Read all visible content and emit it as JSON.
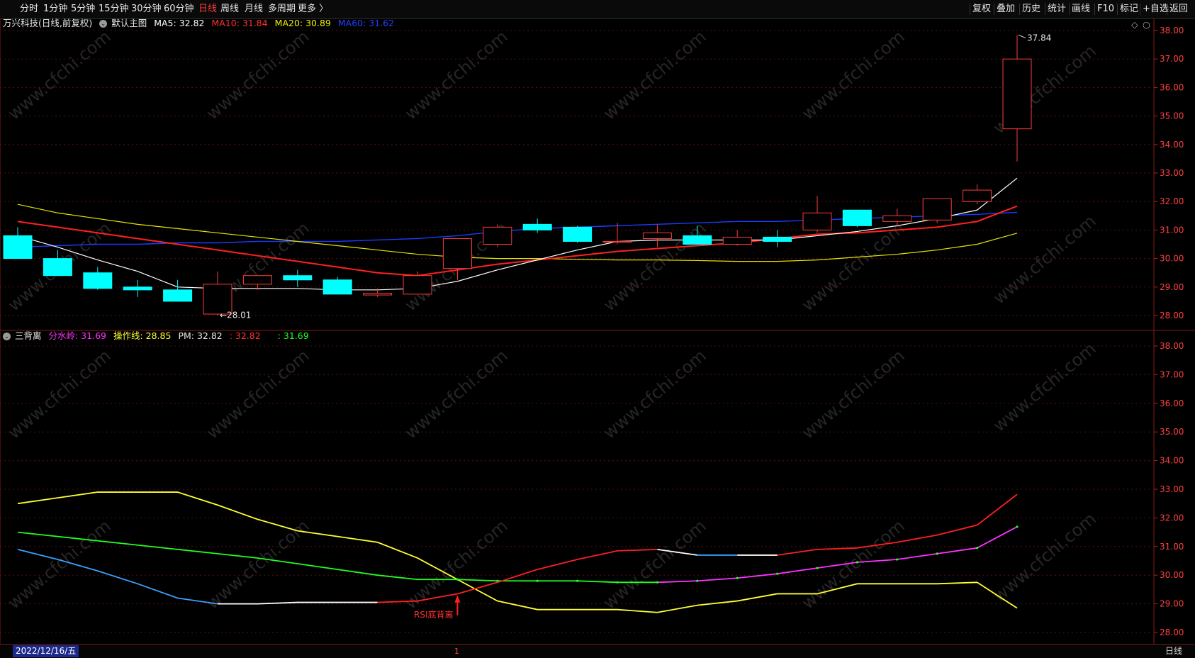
{
  "toolbar": {
    "periods": [
      "分时",
      "1分钟",
      "5分钟",
      "15分钟",
      "30分钟",
      "60分钟",
      "日线",
      "周线",
      "月线",
      "多周期",
      "更多 〉"
    ],
    "active_period": "日线",
    "right_items": [
      "复权",
      "叠加",
      "历史",
      "统计",
      "画线",
      "F10",
      "标记",
      "+自选",
      "返回"
    ]
  },
  "main_panel": {
    "stock_title": "万兴科技(日线,前复权)",
    "template_label": "默认主图",
    "ma5": "MA5: 32.82",
    "ma10": "MA10: 31.84",
    "ma20": "MA20: 30.89",
    "ma60": "MA60: 31.62",
    "high_marker": "37.84",
    "low_marker": "28.01",
    "axis_ticks": [
      "38.00",
      "37.00",
      "36.00",
      "35.00",
      "34.00",
      "33.00",
      "32.00",
      "31.00",
      "30.00",
      "29.00",
      "28.00"
    ]
  },
  "sub_panel": {
    "indicator_name": "三背离",
    "fenshuiling": "分水岭: 31.69",
    "caozuoxian": "操作线: 28.85",
    "pm": "PM: 32.82",
    "red_value": ": 32.82",
    "green_value": ": 31.69",
    "signal_label": "RSI底背离",
    "axis_ticks": [
      "38.00",
      "37.00",
      "36.00",
      "35.00",
      "34.00",
      "33.00",
      "32.00",
      "31.00",
      "30.00",
      "29.00",
      "28.00"
    ]
  },
  "status_bar": {
    "date": "2022/12/16/五",
    "cursor_marker": "1",
    "period": "日线"
  },
  "watermark": "www.cfchi.com",
  "colors": {
    "up": "#ff3c3c",
    "down": "#00ffff",
    "ma5": "#ffffff",
    "ma10": "#ff2020",
    "ma20": "#e6e600",
    "ma60": "#1a3cff",
    "fenshuiling": "#ff33ff",
    "caozuoxian": "#ffff33",
    "green_line": "#22ff22",
    "blue_line": "#3aa0ff"
  },
  "chart_data": {
    "type": "candlestick",
    "ylim": [
      27.6,
      38.3
    ],
    "candles": [
      {
        "o": 30.8,
        "h": 31.1,
        "l": 30.0,
        "c": 30.0
      },
      {
        "o": 30.0,
        "h": 30.3,
        "l": 29.4,
        "c": 29.4
      },
      {
        "o": 29.5,
        "h": 29.7,
        "l": 28.9,
        "c": 28.95
      },
      {
        "o": 29.0,
        "h": 29.25,
        "l": 28.65,
        "c": 28.9
      },
      {
        "o": 28.9,
        "h": 29.25,
        "l": 28.5,
        "c": 28.5
      },
      {
        "o": 28.05,
        "h": 29.55,
        "l": 28.01,
        "c": 29.1
      },
      {
        "o": 29.1,
        "h": 29.4,
        "l": 28.9,
        "c": 29.4
      },
      {
        "o": 29.4,
        "h": 29.6,
        "l": 29.0,
        "c": 29.25
      },
      {
        "o": 29.25,
        "h": 29.35,
        "l": 28.75,
        "c": 28.75
      },
      {
        "o": 28.72,
        "h": 28.95,
        "l": 28.65,
        "c": 28.78
      },
      {
        "o": 28.75,
        "h": 29.55,
        "l": 28.75,
        "c": 29.4
      },
      {
        "o": 29.65,
        "h": 30.7,
        "l": 29.25,
        "c": 30.7
      },
      {
        "o": 30.5,
        "h": 31.2,
        "l": 30.4,
        "c": 31.1
      },
      {
        "o": 31.2,
        "h": 31.4,
        "l": 30.9,
        "c": 31.0
      },
      {
        "o": 31.1,
        "h": 31.15,
        "l": 30.55,
        "c": 30.6
      },
      {
        "o": 30.6,
        "h": 31.25,
        "l": 30.5,
        "c": 30.6
      },
      {
        "o": 30.7,
        "h": 31.2,
        "l": 30.4,
        "c": 30.9
      },
      {
        "o": 30.8,
        "h": 31.15,
        "l": 30.5,
        "c": 30.5
      },
      {
        "o": 30.5,
        "h": 31.0,
        "l": 30.45,
        "c": 30.75
      },
      {
        "o": 30.75,
        "h": 31.0,
        "l": 30.4,
        "c": 30.6
      },
      {
        "o": 31.0,
        "h": 32.2,
        "l": 30.9,
        "c": 31.6
      },
      {
        "o": 31.7,
        "h": 31.7,
        "l": 31.1,
        "c": 31.15
      },
      {
        "o": 31.3,
        "h": 31.75,
        "l": 31.15,
        "c": 31.5
      },
      {
        "o": 31.35,
        "h": 32.1,
        "l": 31.25,
        "c": 32.1
      },
      {
        "o": 32.0,
        "h": 32.6,
        "l": 31.9,
        "c": 32.4
      },
      {
        "o": 34.55,
        "h": 37.84,
        "l": 33.4,
        "c": 37.0
      }
    ],
    "ma5": [
      30.8,
      30.4,
      29.95,
      29.55,
      29.0,
      28.95,
      28.95,
      28.95,
      28.9,
      28.9,
      28.95,
      29.2,
      29.6,
      29.95,
      30.3,
      30.6,
      30.65,
      30.65,
      30.65,
      30.65,
      30.8,
      30.95,
      31.15,
      31.4,
      31.7,
      32.82
    ],
    "ma10": [
      31.3,
      31.1,
      30.9,
      30.7,
      30.5,
      30.3,
      30.1,
      29.9,
      29.7,
      29.5,
      29.4,
      29.6,
      29.8,
      29.95,
      30.1,
      30.25,
      30.35,
      30.45,
      30.55,
      30.7,
      30.85,
      30.9,
      31.0,
      31.1,
      31.3,
      31.84
    ],
    "ma20": [
      31.9,
      31.6,
      31.4,
      31.2,
      31.05,
      30.9,
      30.75,
      30.6,
      30.45,
      30.3,
      30.15,
      30.05,
      30.0,
      30.0,
      29.97,
      29.95,
      29.95,
      29.93,
      29.9,
      29.9,
      29.95,
      30.05,
      30.15,
      30.3,
      30.5,
      30.89
    ],
    "ma60": [
      30.4,
      30.45,
      30.5,
      30.5,
      30.55,
      30.55,
      30.6,
      30.6,
      30.6,
      30.65,
      30.7,
      30.8,
      30.95,
      31.05,
      31.1,
      31.15,
      31.2,
      31.25,
      31.3,
      31.3,
      31.35,
      31.4,
      31.45,
      31.5,
      31.55,
      31.62
    ],
    "sub_ylim": [
      27.6,
      38.3
    ],
    "caozuoxian": [
      32.5,
      32.7,
      32.9,
      32.9,
      32.9,
      32.45,
      31.95,
      31.55,
      31.35,
      31.15,
      30.6,
      29.85,
      29.1,
      28.8,
      28.8,
      28.8,
      28.7,
      28.95,
      29.1,
      29.35,
      29.35,
      29.7,
      29.7,
      29.7,
      29.75,
      28.85
    ],
    "fenshuiling": [
      31.5,
      31.35,
      31.2,
      31.05,
      30.9,
      30.75,
      30.6,
      30.4,
      30.2,
      30.0,
      29.85,
      29.85,
      29.8,
      29.8,
      29.8,
      29.75,
      29.75,
      29.8,
      29.9,
      30.05,
      30.25,
      30.45,
      30.55,
      30.75,
      30.95,
      31.69
    ],
    "pm": [
      30.9,
      30.55,
      30.15,
      29.7,
      29.2,
      29.0,
      29.0,
      29.05,
      29.05,
      29.05,
      29.1,
      29.35,
      29.75,
      30.2,
      30.55,
      30.85,
      30.9,
      30.7,
      30.7,
      30.7,
      30.9,
      30.95,
      31.15,
      31.4,
      31.75,
      32.82
    ]
  }
}
